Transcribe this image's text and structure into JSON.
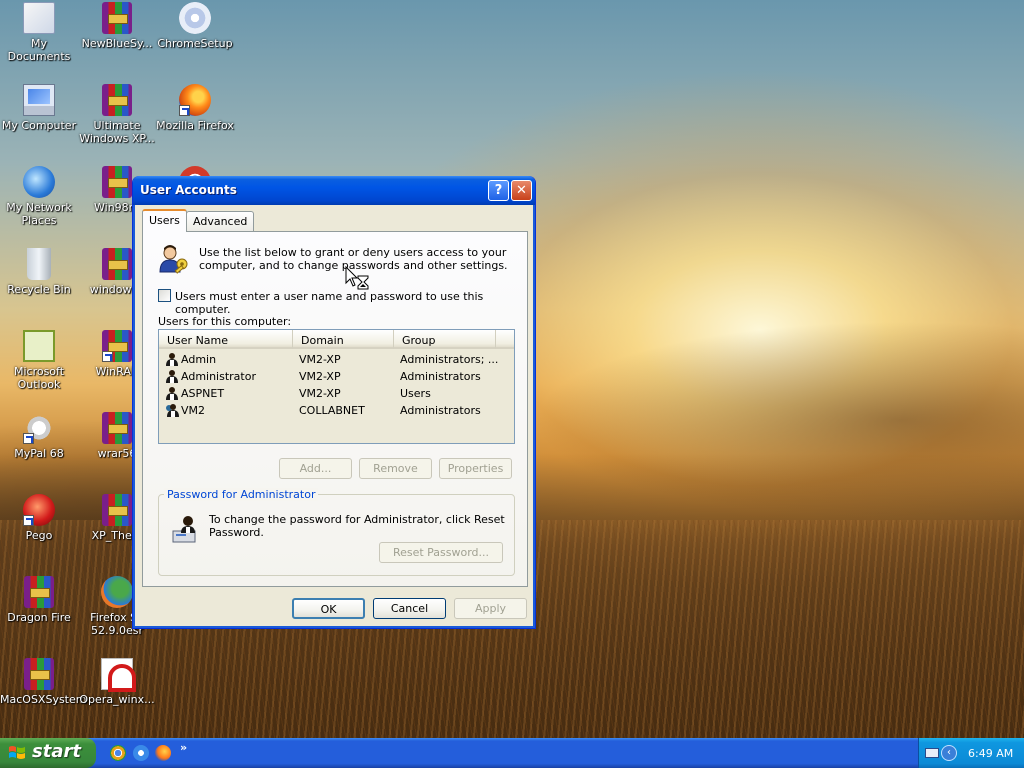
{
  "desktop": {
    "icons": [
      {
        "label": "My Documents",
        "icon": "my-documents-icon"
      },
      {
        "label": "NewBlueSy...",
        "icon": "winrar-archive-icon"
      },
      {
        "label": "ChromeSetup",
        "icon": "cd-setup-icon"
      },
      {
        "label": "My Computer",
        "icon": "my-computer-icon"
      },
      {
        "label": "Ultimate\nWindows XP...",
        "icon": "winrar-archive-icon"
      },
      {
        "label": "Mozilla Firefox",
        "icon": "firefox-icon"
      },
      {
        "label": "My Network\nPlaces",
        "icon": "network-places-icon"
      },
      {
        "label": "Win98rd",
        "icon": "winrar-archive-icon"
      },
      {
        "label": "Recycle Bin",
        "icon": "recycle-bin-icon"
      },
      {
        "label": "windows2",
        "icon": "winrar-archive-icon"
      },
      {
        "label": "Microsoft\nOutlook",
        "icon": "outlook-icon"
      },
      {
        "label": "WinRAR",
        "icon": "winrar-icon"
      },
      {
        "label": "MyPal 68",
        "icon": "mypal-icon"
      },
      {
        "label": "wrar56",
        "icon": "winrar-archive-icon"
      },
      {
        "label": "Pego",
        "icon": "pego-icon"
      },
      {
        "label": "XP_Them",
        "icon": "winrar-archive-icon"
      },
      {
        "label": "Dragon Fire",
        "icon": "winrar-archive-icon"
      },
      {
        "label": "Firefox Se\n52.9.0esr",
        "icon": "firefox-esr-icon"
      },
      {
        "label": "MacOSXSystem",
        "icon": "winrar-archive-icon"
      },
      {
        "label": "Opera_winx...",
        "icon": "opera-installer-icon"
      }
    ]
  },
  "window": {
    "title": "User Accounts",
    "help_glyph": "?",
    "close_glyph": "✕",
    "tabs": [
      {
        "label": "Users",
        "selected": true
      },
      {
        "label": "Advanced",
        "selected": false
      }
    ],
    "intro_text": "Use the list below to grant or deny users access to your computer, and to change passwords and other settings.",
    "checkbox": {
      "label": "Users must enter a user name and password to use this computer.",
      "checked": false
    },
    "users_label": "Users for this computer:",
    "columns": [
      "User Name",
      "Domain",
      "Group"
    ],
    "rows": [
      {
        "user": "Admin",
        "domain": "VM2-XP",
        "group": "Administrators; ..."
      },
      {
        "user": "Administrator",
        "domain": "VM2-XP",
        "group": "Administrators"
      },
      {
        "user": "ASPNET",
        "domain": "VM2-XP",
        "group": "Users"
      },
      {
        "user": "VM2",
        "domain": "COLLABNET",
        "group": "Administrators"
      }
    ],
    "buttons": {
      "add": "Add...",
      "remove": "Remove",
      "properties": "Properties",
      "reset_password": "Reset Password...",
      "ok": "OK",
      "cancel": "Cancel",
      "apply": "Apply"
    },
    "password_group": {
      "legend": "Password for Administrator",
      "text": "To change the password for Administrator, click Reset Password."
    }
  },
  "taskbar": {
    "start_label": "start",
    "quick_launch": [
      "chrome-icon",
      "internet-explorer-icon",
      "firefox-icon"
    ],
    "more_glyph": "»",
    "clock": "6:49 AM",
    "tray_arrow_glyph": "‹"
  },
  "colors": {
    "titlebar": "#0055e5",
    "start_button": "#3c8f3b",
    "taskbar": "#245edb",
    "window_face": "#ece9d8"
  }
}
